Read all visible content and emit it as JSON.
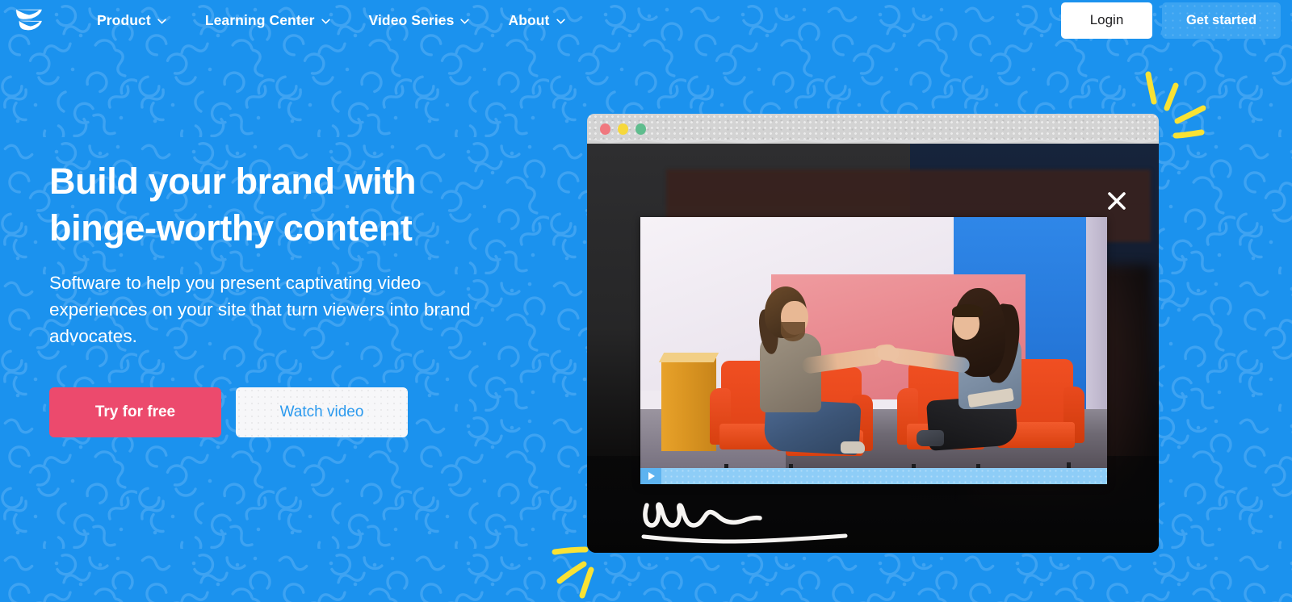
{
  "brand": {
    "logo_icon": "wistia-wings-logo",
    "accent_blue": "#1b92ee",
    "accent_pink": "#ec4a6d",
    "accent_yellow": "#f6d83c",
    "pattern": "squiggle-doodle-pattern"
  },
  "header": {
    "nav": [
      {
        "label": "Product",
        "icon": "chevron-down-icon",
        "has_dropdown": true
      },
      {
        "label": "Learning Center",
        "icon": "chevron-down-icon",
        "has_dropdown": true
      },
      {
        "label": "Video Series",
        "icon": "chevron-down-icon",
        "has_dropdown": true
      },
      {
        "label": "About",
        "icon": "chevron-down-icon",
        "has_dropdown": true
      }
    ],
    "login_label": "Login",
    "get_started_label": "Get started"
  },
  "hero": {
    "headline_line1": "Build your brand with",
    "headline_line2": "binge-worthy content",
    "subheadline": "Software to help you present captivating video experiences on your site that turn viewers into brand advocates.",
    "primary_cta": "Try for free",
    "secondary_cta": "Watch video"
  },
  "mock_window": {
    "traffic_lights": [
      "red",
      "yellow",
      "green"
    ],
    "close_icon": "close-x-icon",
    "player": {
      "play_icon": "play-triangle-icon",
      "progress_percent": 0,
      "scene_description": "two people shaking hands seated in orange armchairs on a studio set"
    },
    "annotations": {
      "scribble": "hand-drawn-scribble",
      "underline": "hand-drawn-underline"
    }
  },
  "decorations": {
    "sparkle_top_right": "yellow-sparkle-lines",
    "sparkle_bottom_left": "yellow-sparkle-lines"
  }
}
